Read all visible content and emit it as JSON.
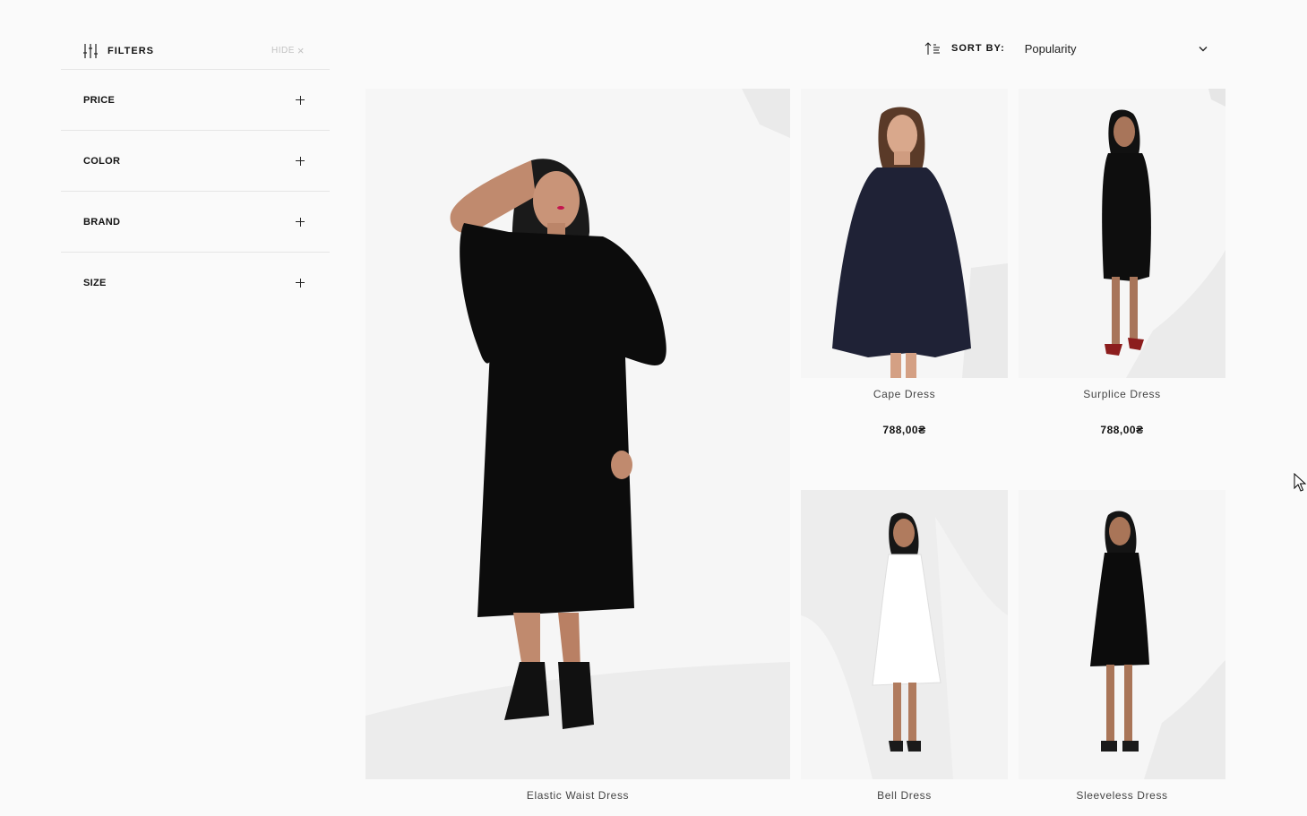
{
  "filters": {
    "title": "FILTERS",
    "hide_label": "HIDE",
    "hide_icon": "close-icon",
    "items": [
      {
        "label": "PRICE"
      },
      {
        "label": "COLOR"
      },
      {
        "label": "BRAND"
      },
      {
        "label": "SIZE"
      }
    ]
  },
  "sort": {
    "label": "SORT BY:",
    "selected": "Popularity",
    "icon": "sort-ascending-icon"
  },
  "products": [
    {
      "name": "Elastic Waist Dress",
      "price": ""
    },
    {
      "name": "Cape Dress",
      "price": "788,00₴"
    },
    {
      "name": "Surplice Dress",
      "price": "788,00₴"
    },
    {
      "name": "Bell Dress",
      "price": ""
    },
    {
      "name": "Sleeveless Dress",
      "price": ""
    }
  ],
  "colors": {
    "background": "#fafafa",
    "photo_bg": "#ededed",
    "text": "#111111",
    "muted": "#c2c2c2",
    "divider": "#e6e6e6"
  }
}
